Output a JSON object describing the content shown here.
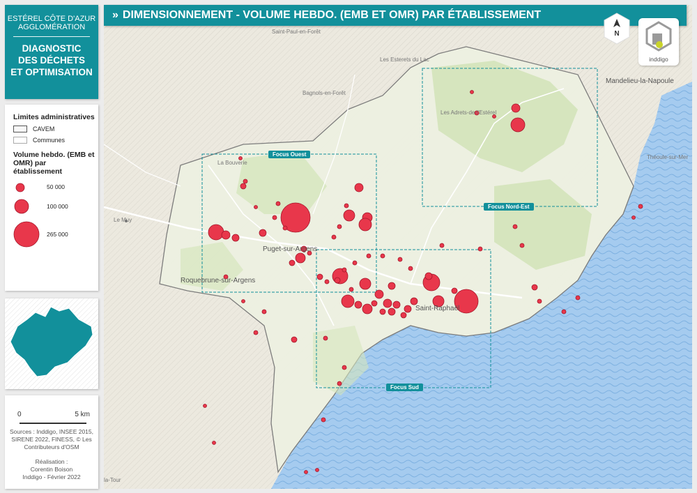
{
  "brand": {
    "org_line1": "ESTÉREL CÔTE D'AZUR",
    "org_line2": "AGGLOMÉRATION",
    "study_line1": "DIAGNOSTIC",
    "study_line2": "DES DÉCHETS",
    "study_line3": "ET OPTIMISATION"
  },
  "title": {
    "chevron": "»",
    "text": "DIMENSIONNEMENT - VOLUME HEBDO. (EMB ET OMR) PAR ÉTABLISSEMENT"
  },
  "legend": {
    "admin_title": "Limites administratives",
    "cavem_label": "CAVEM",
    "communes_label": "Communes",
    "volume_title_line1": "Volume hebdo. (EMB et",
    "volume_title_line2": "OMR) par établissement",
    "size_small": "50 000",
    "size_medium": "100 000",
    "size_large": "265 000",
    "circle_color": "#e8374b"
  },
  "scale": {
    "left_label": "0",
    "right_label": "5 km"
  },
  "sources": {
    "line1": "Sources : Inddigo, INSEE 2015,",
    "line2": "SIRENE 2022, FINESS, © Les",
    "line3": "Contributeurs d'OSM"
  },
  "realisation": {
    "line1": "Réalisation :",
    "line2": "Corentin Boison",
    "line3": "Inddigo - Février 2022"
  },
  "north": {
    "letter": "N"
  },
  "logo": {
    "name": "inddigo"
  },
  "places": {
    "saint_paul": "Saint-Paul-en-Forêt",
    "esterets_lac": "Les Esterets du Lac",
    "bagnols": "Bagnols-en-Forêt",
    "mandelieu": "Mandelieu-la-Napoule",
    "adrets": "Les Adrets-de-l'Estérel",
    "theoule": "Théoule-sur-Mer",
    "bouverie": "La Bouverie",
    "le_muy": "Le Muy",
    "puget": "Puget-sur-Argens",
    "roquebrune": "Roquebrune-sur-Argens",
    "saint_raphael": "Saint-Raphaël",
    "la_tour": "la-Tour"
  },
  "focus": {
    "ouest": "Focus Ouest",
    "nord_est": "Focus Nord-Est",
    "sud": "Focus Sud"
  }
}
